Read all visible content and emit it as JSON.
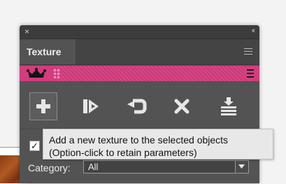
{
  "window": {
    "close_glyph": "×",
    "collapse_glyph": "‹‹"
  },
  "panel": {
    "tab_label": "Texture"
  },
  "header": {
    "accent_color": "#d33c7e",
    "crown_icon": "crown-icon"
  },
  "toolbar": {
    "tools": [
      {
        "name": "add-texture-button",
        "icon": "plus-icon"
      },
      {
        "name": "apply-texture-button",
        "icon": "apply-arrow-icon"
      },
      {
        "name": "replace-texture-button",
        "icon": "loop-arrow-icon"
      },
      {
        "name": "remove-texture-button",
        "icon": "x-icon"
      },
      {
        "name": "import-texture-button",
        "icon": "stack-down-icon"
      }
    ]
  },
  "checkbox": {
    "checked": true,
    "glyph": "✓"
  },
  "category": {
    "label": "Category:",
    "value": "All"
  },
  "tooltip": {
    "line1": "Add a new texture to the selected objects",
    "line2": "(Option-click to retain parameters)"
  }
}
